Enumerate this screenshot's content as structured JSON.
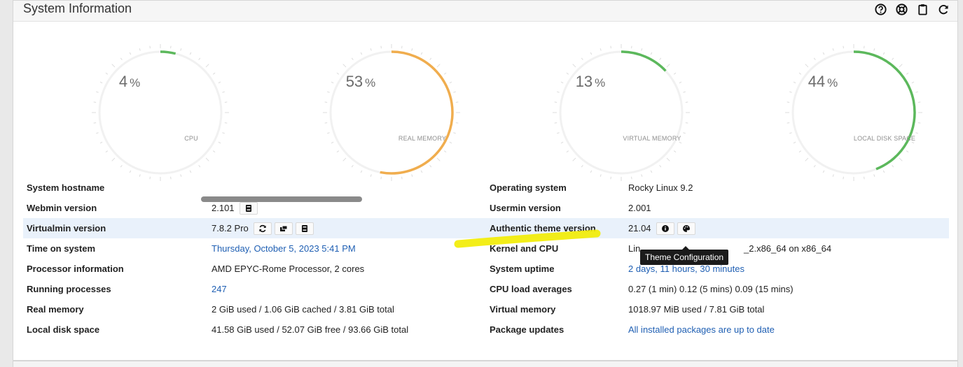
{
  "panel": {
    "title": "System Information",
    "tools": [
      {
        "name": "help-icon"
      },
      {
        "name": "lifebuoy-icon"
      },
      {
        "name": "clipboard-icon"
      },
      {
        "name": "refresh-icon"
      }
    ]
  },
  "gauges": [
    {
      "value": "4",
      "unit": "%",
      "label": "CPU",
      "percent": 4,
      "color": "#5cb85c"
    },
    {
      "value": "53",
      "unit": "%",
      "label": "REAL MEMORY",
      "percent": 53,
      "color": "#f0ad4e"
    },
    {
      "value": "13",
      "unit": "%",
      "label": "VIRTUAL MEMORY",
      "percent": 13,
      "color": "#5cb85c"
    },
    {
      "value": "44",
      "unit": "%",
      "label": "LOCAL DISK SPACE",
      "percent": 44,
      "color": "#5cb85c"
    }
  ],
  "rows": [
    {
      "left_label": "System hostname",
      "left_value": "",
      "right_label": "Operating system",
      "right_value": "Rocky Linux 9.2"
    },
    {
      "left_label": "Webmin version",
      "left_value": "2.101",
      "right_label": "Usermin version",
      "right_value": "2.001"
    },
    {
      "left_label": "Virtualmin version",
      "left_value": "7.8.2 Pro",
      "right_label": "Authentic theme version",
      "right_value": "21.04"
    },
    {
      "left_label": "Time on system",
      "left_value": "Thursday, October 5, 2023 5:41 PM",
      "right_label": "Kernel and CPU",
      "right_value": "Lin",
      "right_value_tail": "_2.x86_64 on x86_64"
    },
    {
      "left_label": "Processor information",
      "left_value": "AMD EPYC-Rome Processor, 2 cores",
      "right_label": "System uptime",
      "right_value": "2 days, 11 hours, 30 minutes"
    },
    {
      "left_label": "Running processes",
      "left_value": "247",
      "right_label": "CPU load averages",
      "right_value": "0.27 (1 min) 0.12 (5 mins) 0.09 (15 mins)"
    },
    {
      "left_label": "Real memory",
      "left_value": "2 GiB used / 1.06 GiB cached / 3.81 GiB total",
      "right_label": "Virtual memory",
      "right_value": "1018.97 MiB used / 7.81 GiB total"
    },
    {
      "left_label": "Local disk space",
      "left_value": "41.58 GiB used / 52.07 GiB free / 93.66 GiB total",
      "right_label": "Package updates",
      "right_value": "All installed packages are up to date"
    }
  ],
  "tooltip": {
    "text": "Theme Configuration"
  },
  "colors": {
    "link": "#1f5fb3",
    "highlight_row": "#e9f1fb",
    "marker": "#f2ec00"
  }
}
